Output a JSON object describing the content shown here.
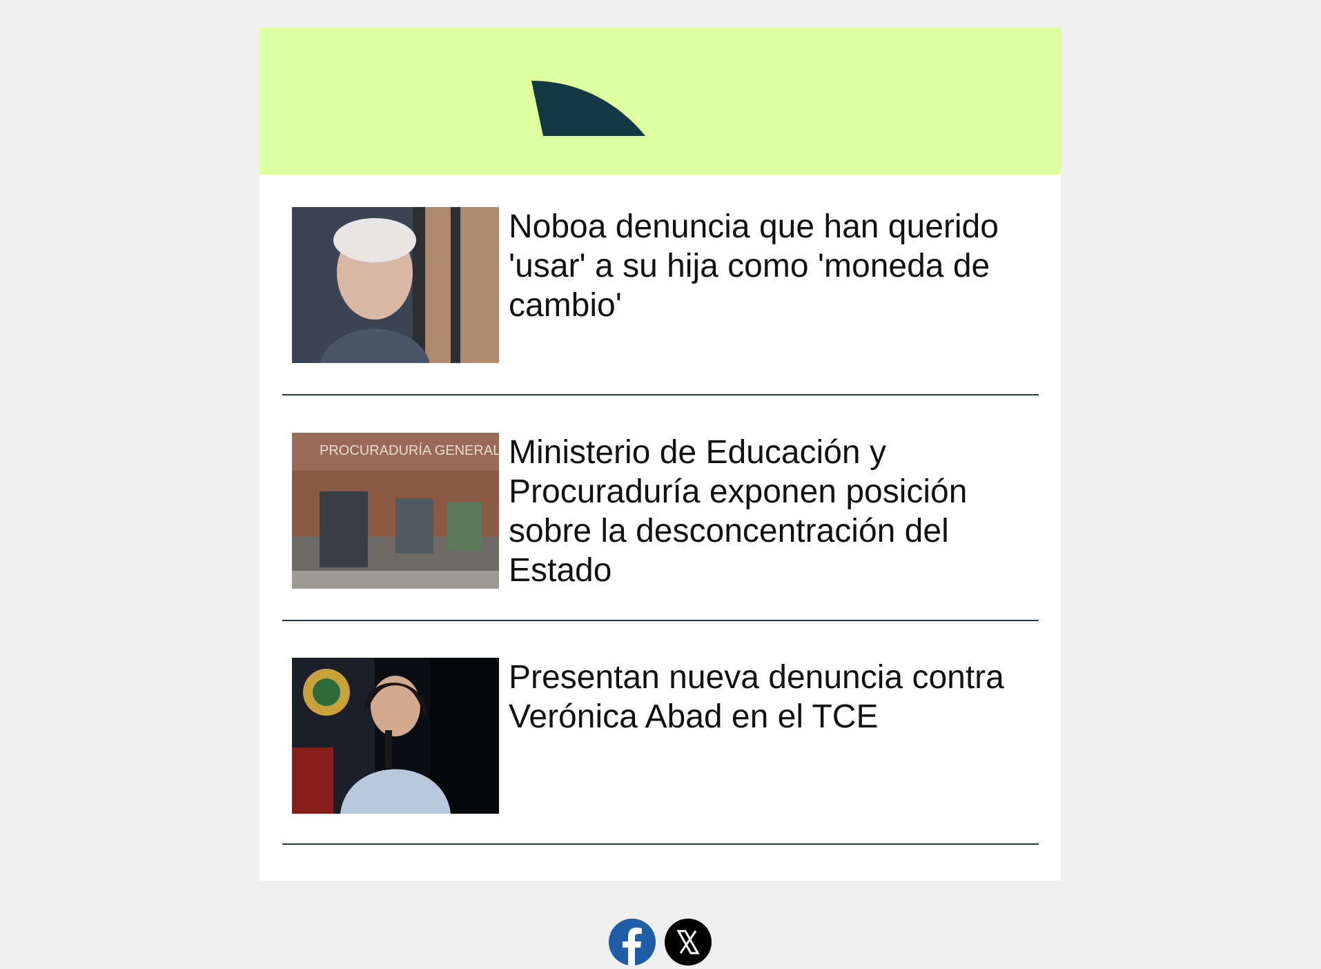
{
  "colors": {
    "page_background": "#efefef",
    "header_background": "#e0ffa1",
    "logo": "#123844",
    "divider": "#1d3a40",
    "facebook": "#1f5da9",
    "x": "#000000"
  },
  "header": {
    "logo_icon": "half-arc-logo-icon"
  },
  "news": [
    {
      "title": "Noboa denuncia que han querido 'usar' a su hija como 'moneda de cambio'",
      "thumbnail_icon": "news-photo-man-portrait"
    },
    {
      "title": "Ministerio de Educación y Procuraduría exponen posición sobre la desconcentración del Estado",
      "thumbnail_icon": "news-photo-building-facade"
    },
    {
      "title": "Presentan nueva denuncia contra Verónica Abad en el TCE",
      "thumbnail_icon": "news-photo-woman-speaking"
    }
  ],
  "social": [
    {
      "name": "facebook",
      "icon": "facebook-icon",
      "glyph": "f"
    },
    {
      "name": "x",
      "icon": "x-icon",
      "glyph": "X"
    }
  ]
}
